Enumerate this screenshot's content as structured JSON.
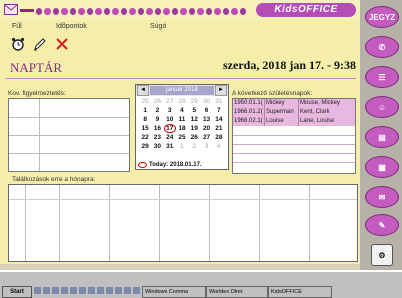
{
  "app": {
    "brand": "KidsOFFICE",
    "menu": [
      "Fűl",
      "Idõpontok",
      "Súgó"
    ],
    "page_title": "NAPTÁR",
    "date_display": "szerda, 2018 jan 17. - 9:38"
  },
  "notes": {
    "label": "Kov. figyelmeztetés:"
  },
  "calendar": {
    "month_label": "január 2018",
    "prev": "◄",
    "next": "►",
    "days": [
      [
        "25",
        "26",
        "27",
        "28",
        "29",
        "30",
        "31"
      ],
      [
        "1",
        "2",
        "3",
        "4",
        "5",
        "6",
        "7"
      ],
      [
        "8",
        "9",
        "10",
        "11",
        "12",
        "13",
        "14"
      ],
      [
        "15",
        "16",
        "17",
        "18",
        "19",
        "20",
        "21"
      ],
      [
        "22",
        "23",
        "24",
        "25",
        "26",
        "27",
        "28"
      ],
      [
        "29",
        "30",
        "31",
        "1",
        "2",
        "3",
        "4"
      ]
    ],
    "today_label": "Today: 2018.01.17."
  },
  "birthdays": {
    "label": "A következő születésnapok:",
    "rows": [
      [
        "1950.01.1(",
        "Mickey",
        "Mouse, Mickey"
      ],
      [
        "1966.01.2(",
        "Superman",
        "Kent, Clark"
      ],
      [
        "1968.02.1(",
        "Louise",
        "Lane, Louise"
      ]
    ]
  },
  "events": {
    "label": "Találkozások erre a hónapra:"
  },
  "sidebar": {
    "top_button": "JEGYZ"
  },
  "taskbar": {
    "start": "Start",
    "tasks": [
      "Windows Comma",
      "Worldex Olrer",
      "KidsOFFICE"
    ]
  },
  "colors": {
    "accent": "#8a2a8a",
    "brand_bg": "#b54db8",
    "app_bg": "#f4eeaa"
  }
}
